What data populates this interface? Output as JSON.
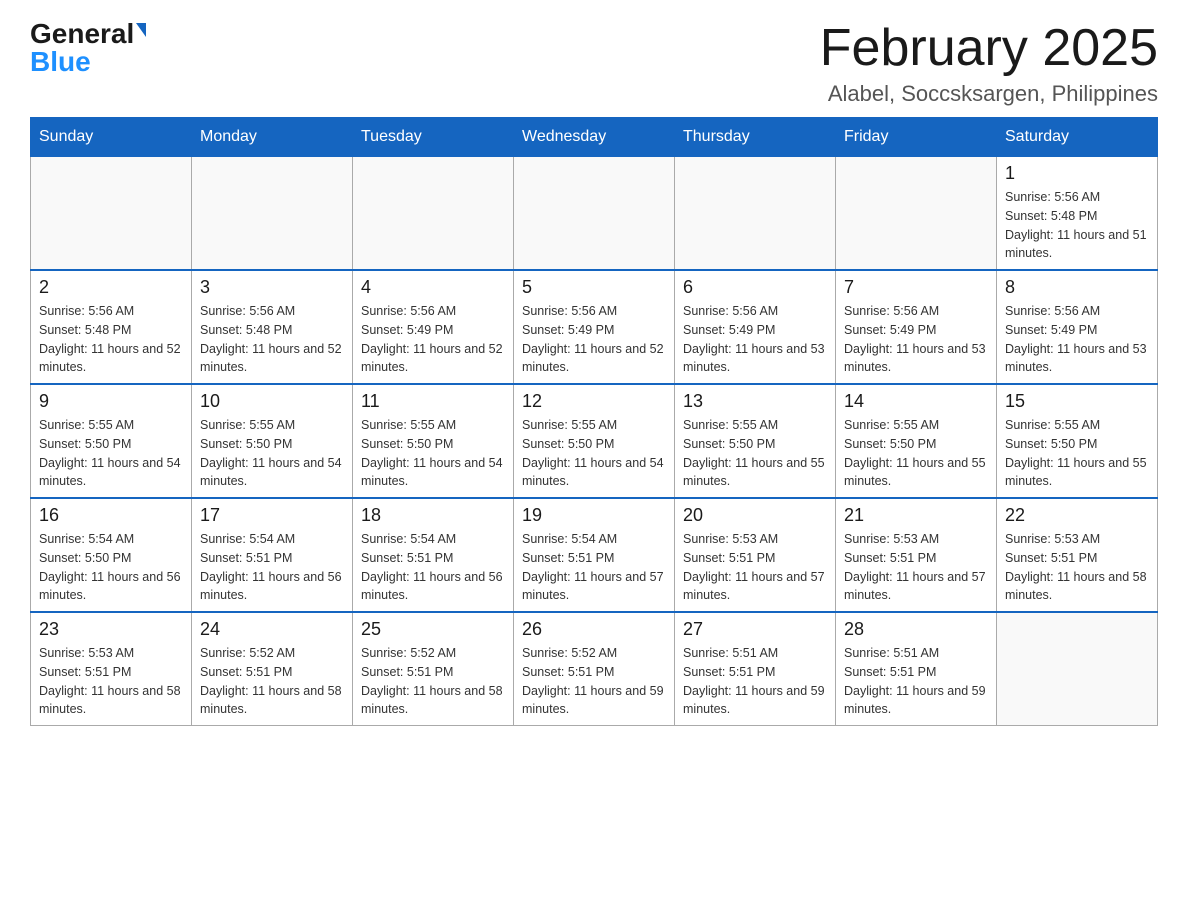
{
  "header": {
    "logo_general": "General",
    "logo_blue": "Blue",
    "month_title": "February 2025",
    "location": "Alabel, Soccsksargen, Philippines"
  },
  "weekdays": [
    "Sunday",
    "Monday",
    "Tuesday",
    "Wednesday",
    "Thursday",
    "Friday",
    "Saturday"
  ],
  "weeks": [
    [
      {
        "day": "",
        "sunrise": "",
        "sunset": "",
        "daylight": ""
      },
      {
        "day": "",
        "sunrise": "",
        "sunset": "",
        "daylight": ""
      },
      {
        "day": "",
        "sunrise": "",
        "sunset": "",
        "daylight": ""
      },
      {
        "day": "",
        "sunrise": "",
        "sunset": "",
        "daylight": ""
      },
      {
        "day": "",
        "sunrise": "",
        "sunset": "",
        "daylight": ""
      },
      {
        "day": "",
        "sunrise": "",
        "sunset": "",
        "daylight": ""
      },
      {
        "day": "1",
        "sunrise": "Sunrise: 5:56 AM",
        "sunset": "Sunset: 5:48 PM",
        "daylight": "Daylight: 11 hours and 51 minutes."
      }
    ],
    [
      {
        "day": "2",
        "sunrise": "Sunrise: 5:56 AM",
        "sunset": "Sunset: 5:48 PM",
        "daylight": "Daylight: 11 hours and 52 minutes."
      },
      {
        "day": "3",
        "sunrise": "Sunrise: 5:56 AM",
        "sunset": "Sunset: 5:48 PM",
        "daylight": "Daylight: 11 hours and 52 minutes."
      },
      {
        "day": "4",
        "sunrise": "Sunrise: 5:56 AM",
        "sunset": "Sunset: 5:49 PM",
        "daylight": "Daylight: 11 hours and 52 minutes."
      },
      {
        "day": "5",
        "sunrise": "Sunrise: 5:56 AM",
        "sunset": "Sunset: 5:49 PM",
        "daylight": "Daylight: 11 hours and 52 minutes."
      },
      {
        "day": "6",
        "sunrise": "Sunrise: 5:56 AM",
        "sunset": "Sunset: 5:49 PM",
        "daylight": "Daylight: 11 hours and 53 minutes."
      },
      {
        "day": "7",
        "sunrise": "Sunrise: 5:56 AM",
        "sunset": "Sunset: 5:49 PM",
        "daylight": "Daylight: 11 hours and 53 minutes."
      },
      {
        "day": "8",
        "sunrise": "Sunrise: 5:56 AM",
        "sunset": "Sunset: 5:49 PM",
        "daylight": "Daylight: 11 hours and 53 minutes."
      }
    ],
    [
      {
        "day": "9",
        "sunrise": "Sunrise: 5:55 AM",
        "sunset": "Sunset: 5:50 PM",
        "daylight": "Daylight: 11 hours and 54 minutes."
      },
      {
        "day": "10",
        "sunrise": "Sunrise: 5:55 AM",
        "sunset": "Sunset: 5:50 PM",
        "daylight": "Daylight: 11 hours and 54 minutes."
      },
      {
        "day": "11",
        "sunrise": "Sunrise: 5:55 AM",
        "sunset": "Sunset: 5:50 PM",
        "daylight": "Daylight: 11 hours and 54 minutes."
      },
      {
        "day": "12",
        "sunrise": "Sunrise: 5:55 AM",
        "sunset": "Sunset: 5:50 PM",
        "daylight": "Daylight: 11 hours and 54 minutes."
      },
      {
        "day": "13",
        "sunrise": "Sunrise: 5:55 AM",
        "sunset": "Sunset: 5:50 PM",
        "daylight": "Daylight: 11 hours and 55 minutes."
      },
      {
        "day": "14",
        "sunrise": "Sunrise: 5:55 AM",
        "sunset": "Sunset: 5:50 PM",
        "daylight": "Daylight: 11 hours and 55 minutes."
      },
      {
        "day": "15",
        "sunrise": "Sunrise: 5:55 AM",
        "sunset": "Sunset: 5:50 PM",
        "daylight": "Daylight: 11 hours and 55 minutes."
      }
    ],
    [
      {
        "day": "16",
        "sunrise": "Sunrise: 5:54 AM",
        "sunset": "Sunset: 5:50 PM",
        "daylight": "Daylight: 11 hours and 56 minutes."
      },
      {
        "day": "17",
        "sunrise": "Sunrise: 5:54 AM",
        "sunset": "Sunset: 5:51 PM",
        "daylight": "Daylight: 11 hours and 56 minutes."
      },
      {
        "day": "18",
        "sunrise": "Sunrise: 5:54 AM",
        "sunset": "Sunset: 5:51 PM",
        "daylight": "Daylight: 11 hours and 56 minutes."
      },
      {
        "day": "19",
        "sunrise": "Sunrise: 5:54 AM",
        "sunset": "Sunset: 5:51 PM",
        "daylight": "Daylight: 11 hours and 57 minutes."
      },
      {
        "day": "20",
        "sunrise": "Sunrise: 5:53 AM",
        "sunset": "Sunset: 5:51 PM",
        "daylight": "Daylight: 11 hours and 57 minutes."
      },
      {
        "day": "21",
        "sunrise": "Sunrise: 5:53 AM",
        "sunset": "Sunset: 5:51 PM",
        "daylight": "Daylight: 11 hours and 57 minutes."
      },
      {
        "day": "22",
        "sunrise": "Sunrise: 5:53 AM",
        "sunset": "Sunset: 5:51 PM",
        "daylight": "Daylight: 11 hours and 58 minutes."
      }
    ],
    [
      {
        "day": "23",
        "sunrise": "Sunrise: 5:53 AM",
        "sunset": "Sunset: 5:51 PM",
        "daylight": "Daylight: 11 hours and 58 minutes."
      },
      {
        "day": "24",
        "sunrise": "Sunrise: 5:52 AM",
        "sunset": "Sunset: 5:51 PM",
        "daylight": "Daylight: 11 hours and 58 minutes."
      },
      {
        "day": "25",
        "sunrise": "Sunrise: 5:52 AM",
        "sunset": "Sunset: 5:51 PM",
        "daylight": "Daylight: 11 hours and 58 minutes."
      },
      {
        "day": "26",
        "sunrise": "Sunrise: 5:52 AM",
        "sunset": "Sunset: 5:51 PM",
        "daylight": "Daylight: 11 hours and 59 minutes."
      },
      {
        "day": "27",
        "sunrise": "Sunrise: 5:51 AM",
        "sunset": "Sunset: 5:51 PM",
        "daylight": "Daylight: 11 hours and 59 minutes."
      },
      {
        "day": "28",
        "sunrise": "Sunrise: 5:51 AM",
        "sunset": "Sunset: 5:51 PM",
        "daylight": "Daylight: 11 hours and 59 minutes."
      },
      {
        "day": "",
        "sunrise": "",
        "sunset": "",
        "daylight": ""
      }
    ]
  ]
}
